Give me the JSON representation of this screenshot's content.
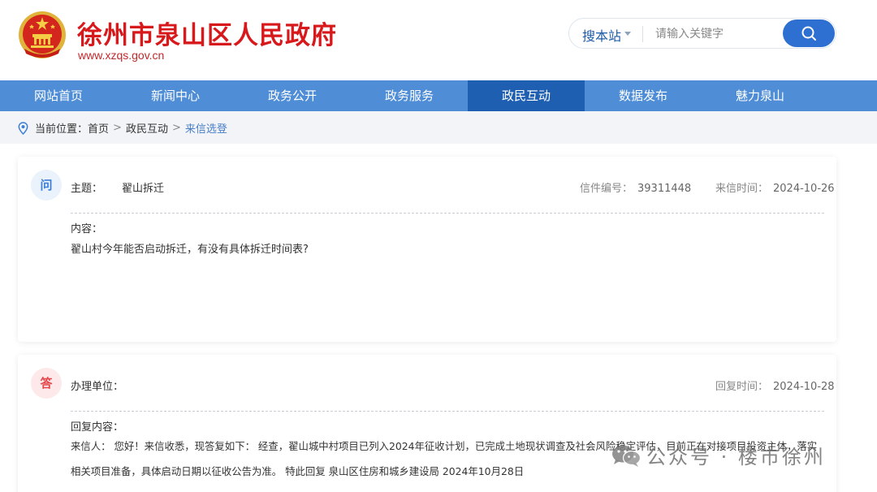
{
  "header": {
    "title": "徐州市泉山区人民政府",
    "url": "www.xzqs.gov.cn",
    "brand_color": "#d7191c"
  },
  "search": {
    "scope": "搜本站",
    "placeholder": "请输入关键字",
    "button_icon": "search-icon"
  },
  "nav": {
    "items": [
      "网站首页",
      "新闻中心",
      "政务公开",
      "政务服务",
      "政民互动",
      "数据发布",
      "魅力泉山"
    ],
    "active": "政民互动",
    "color": "#4f8ed6",
    "active_color": "#1f5fb2"
  },
  "breadcrumb": {
    "label": "当前位置：",
    "items": [
      "首页",
      "政民互动",
      "来信选登"
    ],
    "separator": ">"
  },
  "letter": {
    "badge": "问",
    "subject_label": "主题：",
    "subject": "翟山拆迁",
    "number_label": "信件编号：",
    "number": "39311448",
    "date_label": "来信时间：",
    "date": "2024-10-26",
    "content_label": "内容：",
    "content": "翟山村今年能否启动拆迁，有没有具体拆迁时间表?"
  },
  "reply": {
    "badge": "答",
    "unit_label": "办理单位：",
    "date_label": "回复时间：",
    "date": "2024-10-28",
    "content_label": "回复内容：",
    "content_line1": "来信人：  您好！来信收悉，现答复如下：  经查，翟山城中村项目已列入2024年征收计划，已完成土地现状调查及社会风险稳定评估，目前正在对接项目投资主体，落实",
    "content_line2": "相关项目准备，具体启动日期以征收公告为准。 特此回复 泉山区住房和城乡建设局 2024年10月28日"
  },
  "watermark": {
    "text": "公众号 · 楼市徐州",
    "icon": "wechat-icon"
  }
}
